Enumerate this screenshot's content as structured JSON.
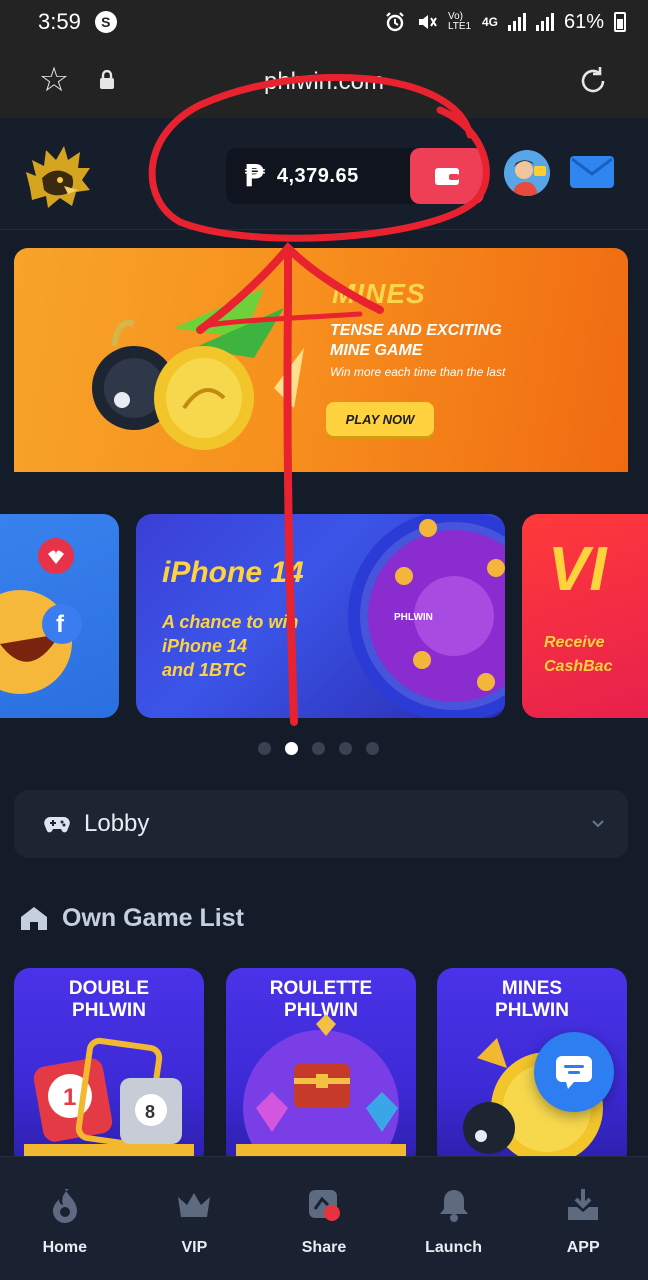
{
  "status_bar": {
    "time": "3:59",
    "s_badge": "S",
    "network": "Vo) LTE1",
    "network_type": "4G",
    "battery": "61%"
  },
  "browser": {
    "url": "phlwin.com"
  },
  "header": {
    "currency_symbol": "₱",
    "balance": "4,379.65"
  },
  "hero": {
    "word": "MINES",
    "title_line1": "TENSE AND EXCITING",
    "title_line2": "MINE GAME",
    "subtitle": "Win more each time than the last",
    "cta": "PLAY NOW"
  },
  "carousel": {
    "mid_title": "iPhone 14",
    "mid_line1": "A chance to win",
    "mid_line2": "iPhone 14",
    "mid_line3": "and 1BTC",
    "wheel_label": "PHLWIN",
    "right_big": "VI",
    "right_line1": "Receive",
    "right_line2": "CashBac",
    "active_index": 1,
    "count": 5
  },
  "lobby": {
    "label": "Lobby"
  },
  "section": {
    "title": "Own Game List"
  },
  "games": [
    {
      "line1": "DOUBLE",
      "line2": "PHLWIN"
    },
    {
      "line1": "ROULETTE",
      "line2": "PHLWIN"
    },
    {
      "line1": "MINES",
      "line2": "PHLWIN"
    }
  ],
  "bottom_nav": [
    {
      "label": "Home",
      "icon": "flame-icon"
    },
    {
      "label": "VIP",
      "icon": "crown-icon"
    },
    {
      "label": "Share",
      "icon": "share-icon"
    },
    {
      "label": "Launch",
      "icon": "bell-icon"
    },
    {
      "label": "APP",
      "icon": "download-icon"
    }
  ],
  "colors": {
    "accent_red": "#ef3f57",
    "background": "#151c29",
    "annotation": "#e8232f"
  }
}
